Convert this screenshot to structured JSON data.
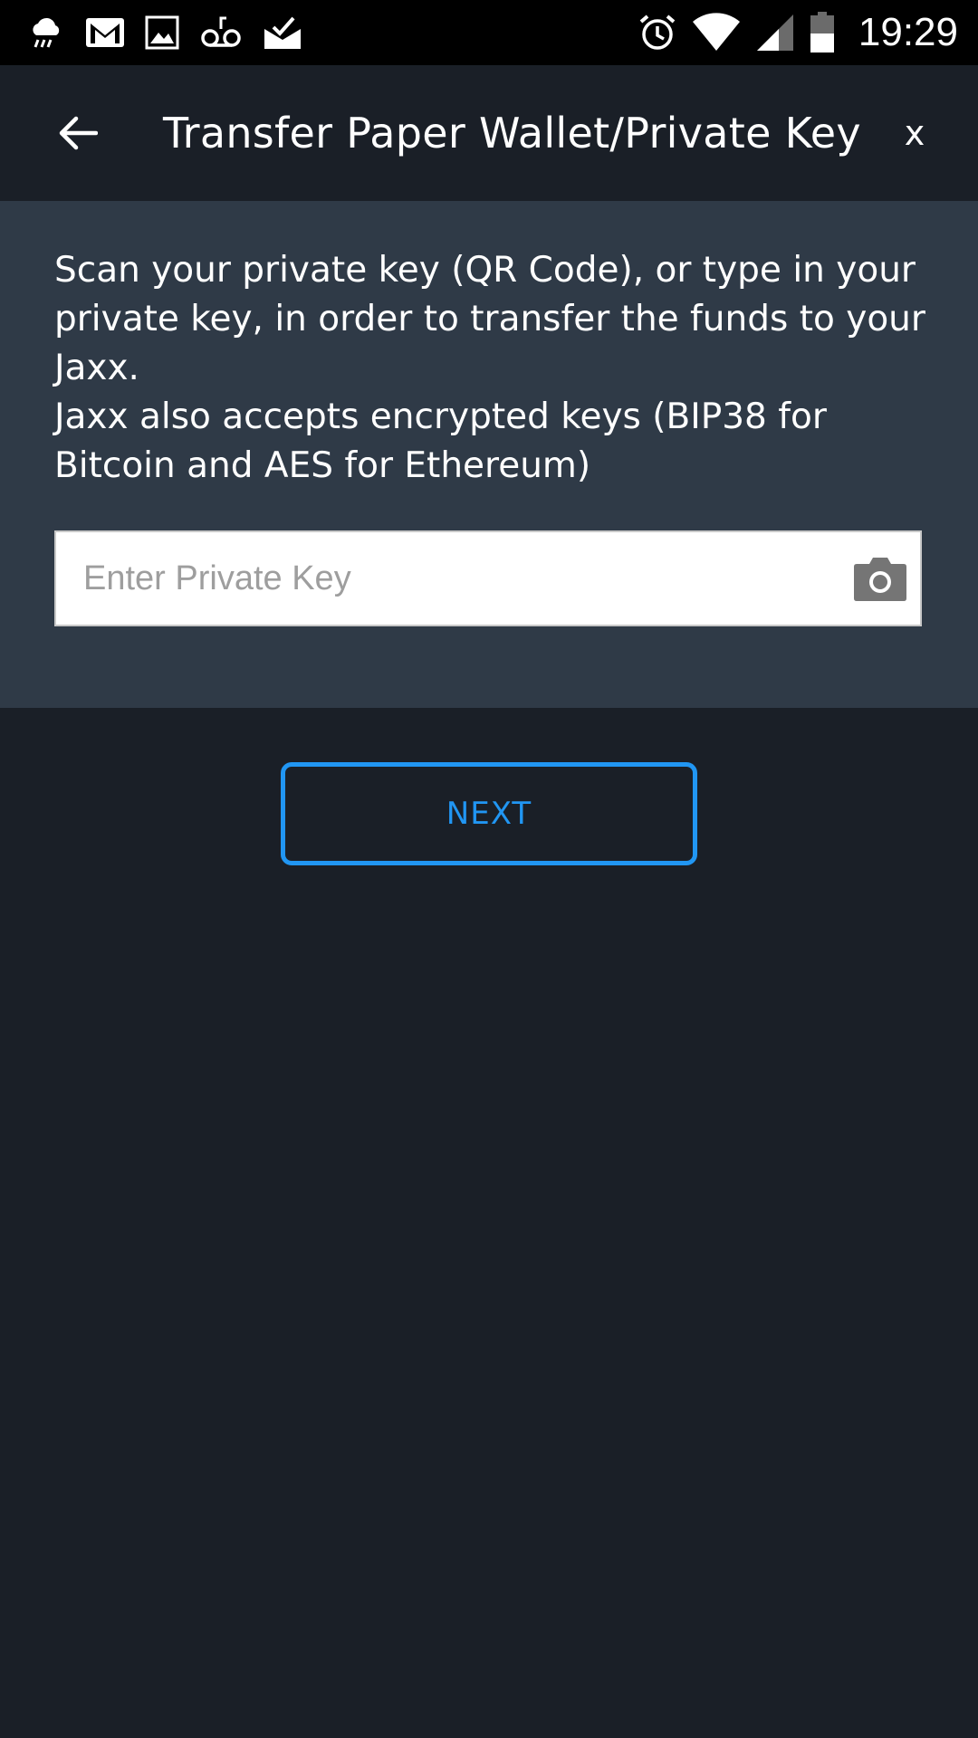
{
  "status_bar": {
    "time": "19:29",
    "left_icons": [
      "rain-cloud-icon",
      "gmail-icon",
      "image-icon",
      "voicemail-icon",
      "mail-check-icon"
    ],
    "right_icons": [
      "alarm-icon",
      "wifi-icon",
      "cell-signal-icon",
      "battery-icon"
    ]
  },
  "header": {
    "title": "Transfer Paper Wallet/Private Key",
    "back_icon": "arrow-left-icon",
    "close_label": "x"
  },
  "instructions": {
    "line1": "Scan your private key (QR Code), or type in your private key, in order to transfer the funds to your Jaxx.",
    "line2": "Jaxx also accepts encrypted keys (BIP38 for Bitcoin and AES for Ethereum)"
  },
  "private_key_input": {
    "value": "",
    "placeholder": "Enter Private Key",
    "icon": "camera-icon"
  },
  "next_button": {
    "label": "NEXT"
  },
  "colors": {
    "background": "#1a1f27",
    "panel": "#2f3a47",
    "accent": "#2196f3",
    "status_bar": "#000000"
  }
}
